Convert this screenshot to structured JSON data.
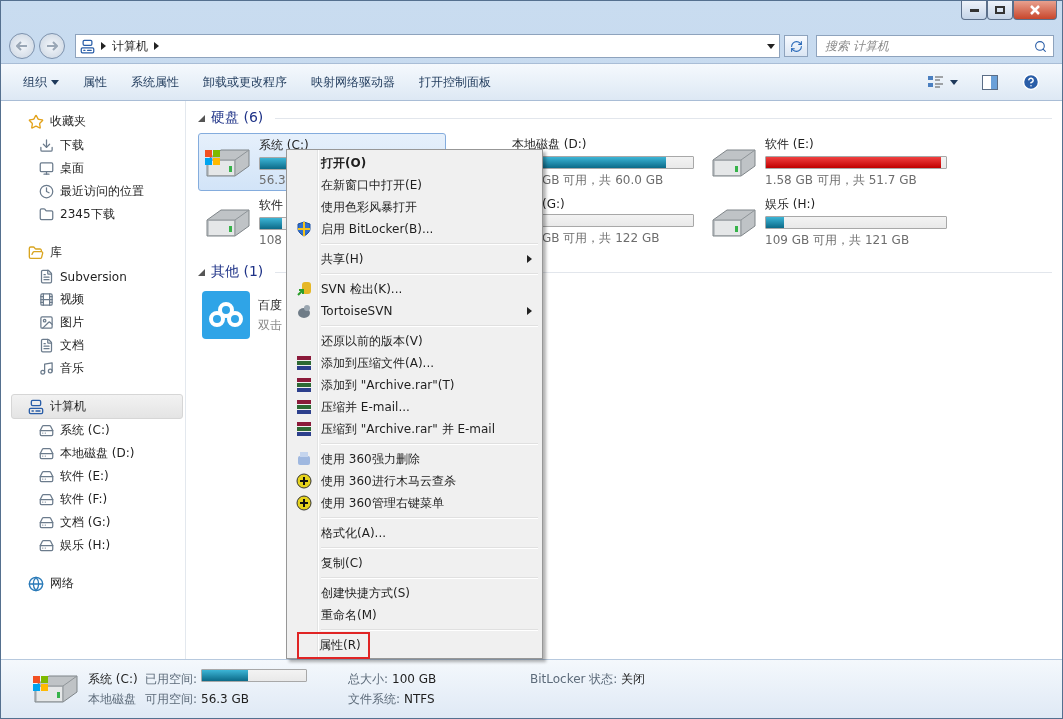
{
  "address": {
    "crumbs": [
      "计算机"
    ]
  },
  "search": {
    "placeholder": "搜索 计算机"
  },
  "toolbar": {
    "items": [
      {
        "label": "组织",
        "dropdown": true
      },
      {
        "label": "属性",
        "dropdown": false
      },
      {
        "label": "系统属性",
        "dropdown": false
      },
      {
        "label": "卸载或更改程序",
        "dropdown": false
      },
      {
        "label": "映射网络驱动器",
        "dropdown": false
      },
      {
        "label": "打开控制面板",
        "dropdown": false
      }
    ]
  },
  "sidebar": {
    "sections": [
      {
        "label": "收藏夹",
        "selected": false,
        "children": [
          {
            "label": "下载",
            "selected": false
          },
          {
            "label": "桌面",
            "selected": false
          },
          {
            "label": "最近访问的位置",
            "selected": false
          },
          {
            "label": "2345下载",
            "selected": false
          }
        ]
      },
      {
        "label": "库",
        "selected": false,
        "children": [
          {
            "label": "Subversion",
            "selected": false
          },
          {
            "label": "视频",
            "selected": false
          },
          {
            "label": "图片",
            "selected": false
          },
          {
            "label": "文档",
            "selected": false
          },
          {
            "label": "音乐",
            "selected": false
          }
        ]
      },
      {
        "label": "计算机",
        "selected": true,
        "children": [
          {
            "label": "系统 (C:)",
            "selected": false
          },
          {
            "label": "本地磁盘 (D:)",
            "selected": false
          },
          {
            "label": "软件 (E:)",
            "selected": false
          },
          {
            "label": "软件 (F:)",
            "selected": false
          },
          {
            "label": "文档 (G:)",
            "selected": false
          },
          {
            "label": "娱乐 (H:)",
            "selected": false
          }
        ]
      },
      {
        "label": "网络",
        "selected": false
      }
    ]
  },
  "groups": [
    {
      "title": "硬盘 (6)",
      "expanded": true,
      "drives": [
        {
          "name": "系统 (C:)",
          "free": "56.3",
          "kind": "system",
          "selected": true,
          "level": 0.44,
          "low_space": false
        },
        {
          "name": "本地磁盘 (D:)",
          "free": "GB 可用，共 60.0 GB",
          "kind": "local",
          "selected": false,
          "level": 0.85,
          "low_space": false
        },
        {
          "name": "软件 (E:)",
          "free": "1.58 GB 可用，共 51.7 GB",
          "kind": "local",
          "selected": false,
          "level": 0.97,
          "low_space": true
        },
        {
          "name": "软件",
          "free": "108",
          "kind": "local",
          "selected": false,
          "level": 0.12,
          "low_space": false
        },
        {
          "name": "(G:)",
          "free": "GB 可用，共 122 GB",
          "kind": "local",
          "selected": false
        },
        {
          "name": "娱乐 (H:)",
          "free": "109 GB 可用，共 121 GB",
          "kind": "local",
          "selected": false,
          "level": 0.1,
          "low_space": false
        }
      ]
    },
    {
      "title": "其他 (1)",
      "expanded": true,
      "apps": [
        {
          "name": "百度",
          "hint": "双击"
        }
      ]
    }
  ],
  "context_menu": {
    "groups": [
      [
        {
          "label": "打开(O)",
          "default": true,
          "submenu": false,
          "marked": false
        },
        {
          "label": "在新窗口中打开(E)",
          "default": false,
          "submenu": false,
          "marked": false
        },
        {
          "label": "使用色彩风暴打开",
          "default": false,
          "submenu": false,
          "marked": false
        },
        {
          "label": "启用 BitLocker(B)...",
          "default": false,
          "submenu": false,
          "marked": false
        }
      ],
      [
        {
          "label": "共享(H)",
          "default": false,
          "submenu": true,
          "marked": false
        }
      ],
      [
        {
          "label": "SVN 检出(K)...",
          "default": false,
          "submenu": false,
          "marked": false
        },
        {
          "label": "TortoiseSVN",
          "default": false,
          "submenu": true,
          "marked": false
        }
      ],
      [
        {
          "label": "还原以前的版本(V)",
          "default": false,
          "submenu": false,
          "marked": false
        },
        {
          "label": "添加到压缩文件(A)...",
          "default": false,
          "submenu": false,
          "marked": false
        },
        {
          "label": "添加到 \"Archive.rar\"(T)",
          "default": false,
          "submenu": false,
          "marked": false
        },
        {
          "label": "压缩并 E-mail...",
          "default": false,
          "submenu": false,
          "marked": false
        },
        {
          "label": "压缩到 \"Archive.rar\" 并 E-mail",
          "default": false,
          "submenu": false,
          "marked": false
        }
      ],
      [
        {
          "label": "使用 360强力删除",
          "default": false,
          "submenu": false,
          "marked": false
        },
        {
          "label": "使用 360进行木马云查杀",
          "default": false,
          "submenu": false,
          "marked": false
        },
        {
          "label": "使用 360管理右键菜单",
          "default": false,
          "submenu": false,
          "marked": false
        }
      ],
      [
        {
          "label": "格式化(A)...",
          "default": false,
          "submenu": false,
          "marked": false
        }
      ],
      [
        {
          "label": "复制(C)",
          "default": false,
          "submenu": false,
          "marked": false
        }
      ],
      [
        {
          "label": "创建快捷方式(S)",
          "default": false,
          "submenu": false,
          "marked": false
        },
        {
          "label": "重命名(M)",
          "default": false,
          "submenu": false,
          "marked": false
        }
      ],
      [
        {
          "label": "属性(R)",
          "default": false,
          "submenu": false,
          "marked": true
        }
      ]
    ]
  },
  "status_bar": {
    "name": "系统 (C:)",
    "type": "本地磁盘",
    "used_label": "已用空间:",
    "level": 0.44,
    "free_label": "可用空间:",
    "free_value": "56.3 GB",
    "fields": [
      {
        "label": "总大小:",
        "value": "100 GB"
      },
      {
        "label": "文件系统:",
        "value": "NTFS"
      },
      {
        "label": "BitLocker 状态:",
        "value": "关闭"
      }
    ]
  }
}
